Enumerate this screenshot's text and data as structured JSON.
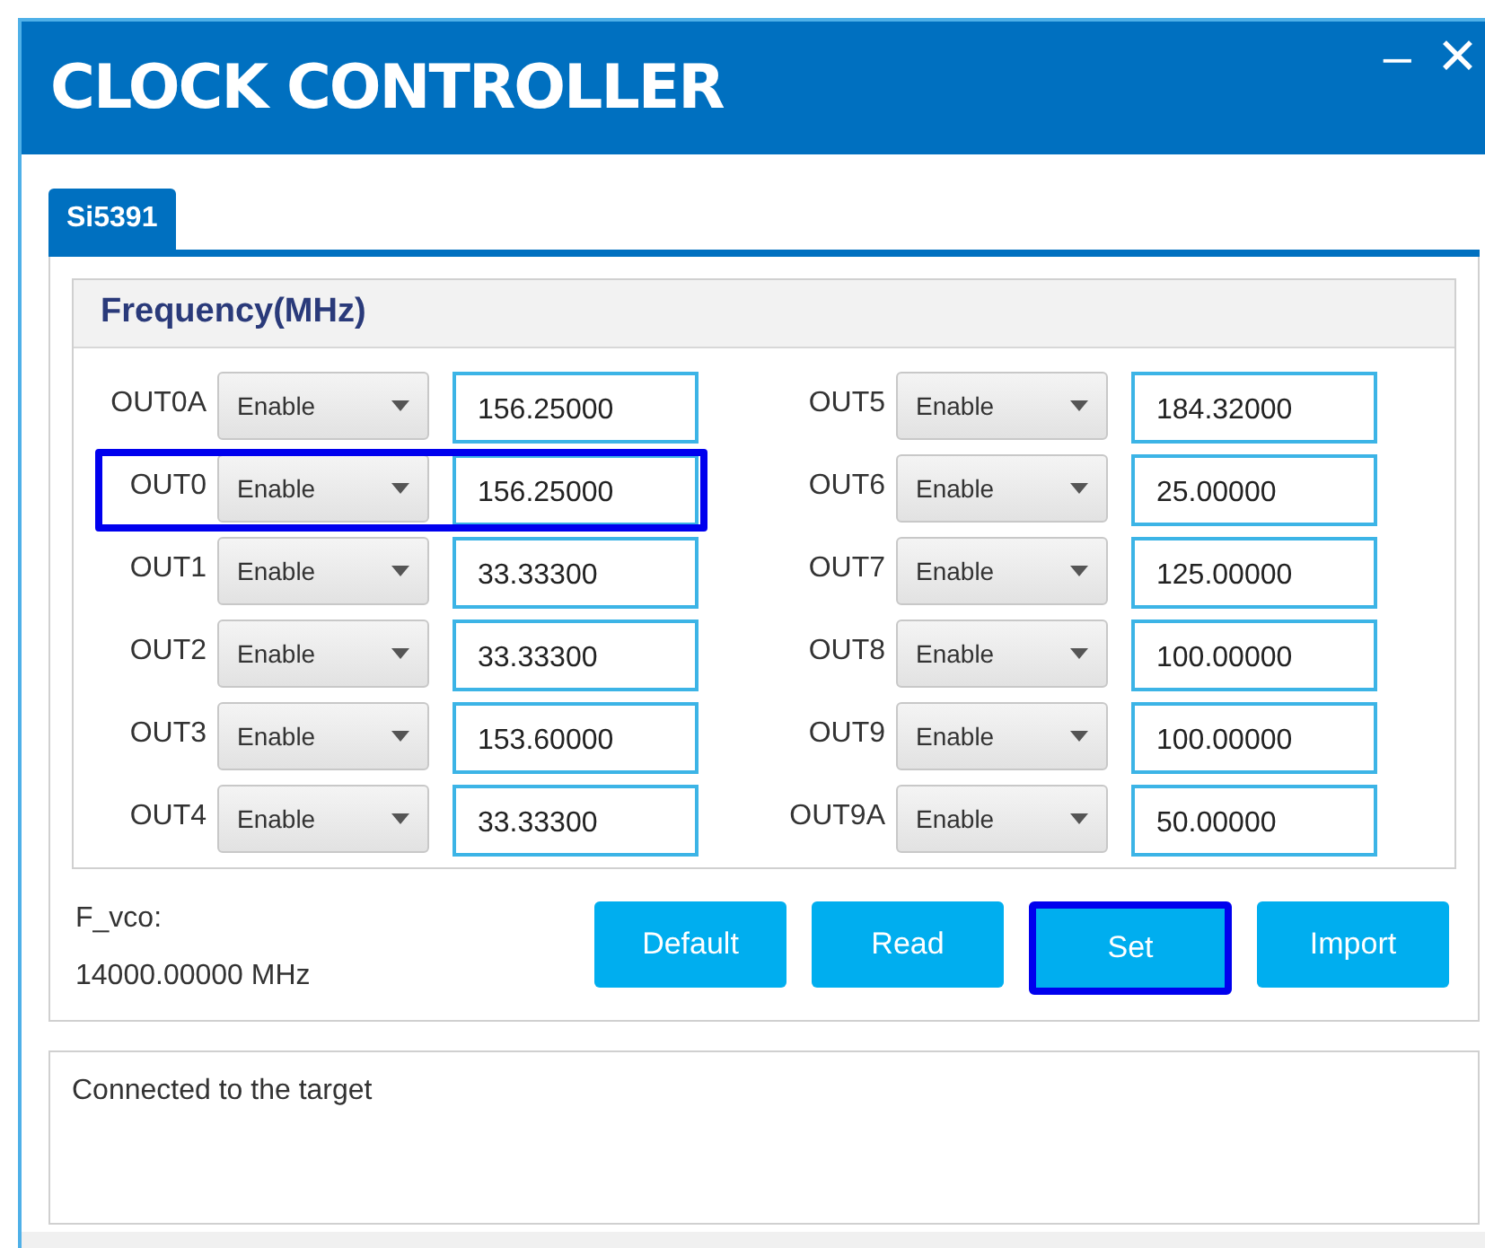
{
  "window": {
    "title": "CLOCK CONTROLLER",
    "minimize": "–",
    "close": "✕"
  },
  "tabs": [
    {
      "label": "Si5391",
      "selected": true
    }
  ],
  "group": {
    "title": "Frequency(MHz)"
  },
  "outputs_left": [
    {
      "label": "OUT0A",
      "mode": "Enable",
      "value": "156.25000",
      "highlighted": false
    },
    {
      "label": "OUT0",
      "mode": "Enable",
      "value": "156.25000",
      "highlighted": true
    },
    {
      "label": "OUT1",
      "mode": "Enable",
      "value": "33.33300",
      "highlighted": false
    },
    {
      "label": "OUT2",
      "mode": "Enable",
      "value": "33.33300",
      "highlighted": false
    },
    {
      "label": "OUT3",
      "mode": "Enable",
      "value": "153.60000",
      "highlighted": false
    },
    {
      "label": "OUT4",
      "mode": "Enable",
      "value": "33.33300",
      "highlighted": false
    }
  ],
  "outputs_right": [
    {
      "label": "OUT5",
      "mode": "Enable",
      "value": "184.32000",
      "highlighted": false
    },
    {
      "label": "OUT6",
      "mode": "Enable",
      "value": "25.00000",
      "highlighted": false
    },
    {
      "label": "OUT7",
      "mode": "Enable",
      "value": "125.00000",
      "highlighted": false
    },
    {
      "label": "OUT8",
      "mode": "Enable",
      "value": "100.00000",
      "highlighted": false
    },
    {
      "label": "OUT9",
      "mode": "Enable",
      "value": "100.00000",
      "highlighted": false
    },
    {
      "label": "OUT9A",
      "mode": "Enable",
      "value": "50.00000",
      "highlighted": false
    }
  ],
  "fvco": {
    "label": "F_vco:",
    "value": "14000.00000 MHz"
  },
  "buttons": [
    {
      "label": "Default",
      "highlighted": false
    },
    {
      "label": "Read",
      "highlighted": false
    },
    {
      "label": "Set",
      "highlighted": true
    },
    {
      "label": "Import",
      "highlighted": false
    }
  ],
  "log": {
    "text": "Connected to the target"
  }
}
